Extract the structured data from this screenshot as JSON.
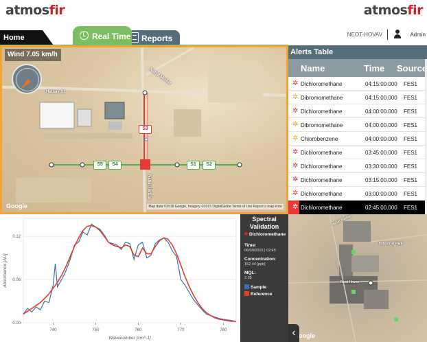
{
  "header": {
    "logo_main": "atmos",
    "logo_accent": "fir",
    "tabs": {
      "home": "Home",
      "realtime": "Real Time",
      "reports": "Reports"
    },
    "station": "NEOT-HOVAV",
    "user": "Admin"
  },
  "map": {
    "wind_label": "Wind 7.05 km/h",
    "google": "Google",
    "attribution": "Map data ©2015 Google, Imagery ©2015 DigitalGlobe   Terms of Use   Report a map error",
    "roads": [
      "Hatsav St",
      "Nahal Mishar",
      "Nahal Ha'Ela"
    ],
    "nodes": {
      "s1": "S1",
      "s2": "S2",
      "s3": "S3",
      "s4": "S4",
      "s5": "S5"
    }
  },
  "alerts": {
    "title": "Alerts Table",
    "columns": {
      "name": "Name",
      "time": "Time",
      "source": "Source"
    },
    "rows": [
      {
        "name": "Dichloromethane",
        "time": "04:15:00.000",
        "source": "FES1",
        "level": "high"
      },
      {
        "name": "Dibromomethane",
        "time": "04:15:00.000",
        "source": "FES1",
        "level": "medium"
      },
      {
        "name": "Dichloromethane",
        "time": "04:00:00.000",
        "source": "FES1",
        "level": "high"
      },
      {
        "name": "Dibromomethane",
        "time": "04:00:00.000",
        "source": "FES1",
        "level": "medium"
      },
      {
        "name": "Chlorobenzene",
        "time": "04:00:00.000",
        "source": "FES1",
        "level": "medium"
      },
      {
        "name": "Dichloromethane",
        "time": "03:45:00.000",
        "source": "FES1",
        "level": "high"
      },
      {
        "name": "Dichloromethane",
        "time": "03:30:00.000",
        "source": "FES1",
        "level": "high"
      },
      {
        "name": "Dichloromethane",
        "time": "03:15:00.000",
        "source": "FES1",
        "level": "high"
      },
      {
        "name": "Dichloromethane",
        "time": "03:00:00.000",
        "source": "FES1",
        "level": "high"
      },
      {
        "name": "Dichloromethane",
        "time": "02:45:00.000",
        "source": "FES1",
        "level": "selected"
      }
    ],
    "colors": {
      "high": "#e53935",
      "medium": "#f5a623"
    }
  },
  "validation": {
    "title": "Spectral Validation",
    "compound": "Dichloromethane",
    "time_label": "Time:",
    "time_value": "06/09/2015 | 02:45",
    "conc_label": "Concentration:",
    "conc_value": "152.44 [ppb]",
    "mql_label": "MQL:",
    "mql_value": "2.35",
    "legend_sample": "Sample",
    "legend_reference": "Reference"
  },
  "satmap": {
    "google": "Google",
    "collapse": "‹",
    "labels": [
      "Nahal Mishar",
      "Neot Hovav",
      "Industrial Park"
    ]
  },
  "chart_data": {
    "type": "line",
    "xlabel": "Wavenumber [cm^-1]",
    "ylabel": "Absorbance [AU]",
    "xlim": [
      733,
      783
    ],
    "ylim": [
      0,
      0.145
    ],
    "xticks": [
      740,
      750,
      760,
      770,
      780
    ],
    "yticks": [
      0.0,
      0.06,
      0.12
    ],
    "ytick_labels": [
      "0.00",
      "0.06",
      "0.12"
    ],
    "series": [
      {
        "name": "Sample",
        "color": "#3b6fb6",
        "x": [
          733,
          734,
          735,
          736,
          737,
          738,
          739,
          740,
          740.5,
          741,
          742,
          743,
          744,
          745,
          746,
          747,
          748,
          749,
          750,
          751,
          752,
          753,
          754,
          755,
          756,
          757,
          758,
          759,
          760,
          761,
          762,
          763,
          764,
          765,
          766,
          767,
          768,
          769,
          770,
          771,
          772,
          773,
          774,
          775,
          776,
          777,
          778,
          779,
          780,
          781,
          782,
          783
        ],
        "y": [
          0.012,
          0.02,
          0.015,
          0.022,
          0.018,
          0.03,
          0.028,
          0.052,
          0.082,
          0.05,
          0.06,
          0.072,
          0.088,
          0.108,
          0.112,
          0.126,
          0.122,
          0.137,
          0.133,
          0.13,
          0.122,
          0.112,
          0.11,
          0.108,
          0.102,
          0.112,
          0.11,
          0.088,
          0.108,
          0.112,
          0.09,
          0.094,
          0.11,
          0.115,
          0.118,
          0.112,
          0.1,
          0.092,
          0.06,
          0.052,
          0.042,
          0.032,
          0.025,
          0.018,
          0.012,
          0.01,
          0.008,
          0.006,
          0.005,
          0.004,
          0.003,
          0.002
        ]
      },
      {
        "name": "Reference",
        "color": "#e0402a",
        "x": [
          733,
          734,
          735,
          736,
          737,
          738,
          739,
          740,
          741,
          742,
          743,
          744,
          745,
          746,
          747,
          748,
          749,
          750,
          751,
          752,
          753,
          754,
          755,
          756,
          757,
          758,
          759,
          760,
          761,
          762,
          763,
          764,
          765,
          766,
          767,
          768,
          769,
          770,
          771,
          772,
          773,
          774,
          775,
          776,
          777,
          778,
          779,
          780,
          781,
          782,
          783
        ],
        "y": [
          0.012,
          0.016,
          0.02,
          0.024,
          0.028,
          0.034,
          0.04,
          0.048,
          0.056,
          0.066,
          0.078,
          0.092,
          0.106,
          0.118,
          0.128,
          0.134,
          0.135,
          0.133,
          0.128,
          0.12,
          0.112,
          0.108,
          0.106,
          0.104,
          0.108,
          0.106,
          0.094,
          0.092,
          0.104,
          0.096,
          0.096,
          0.106,
          0.114,
          0.118,
          0.116,
          0.108,
          0.096,
          0.08,
          0.064,
          0.05,
          0.038,
          0.028,
          0.02,
          0.014,
          0.01,
          0.007,
          0.005,
          0.004,
          0.003,
          0.002,
          0.002
        ]
      }
    ]
  }
}
